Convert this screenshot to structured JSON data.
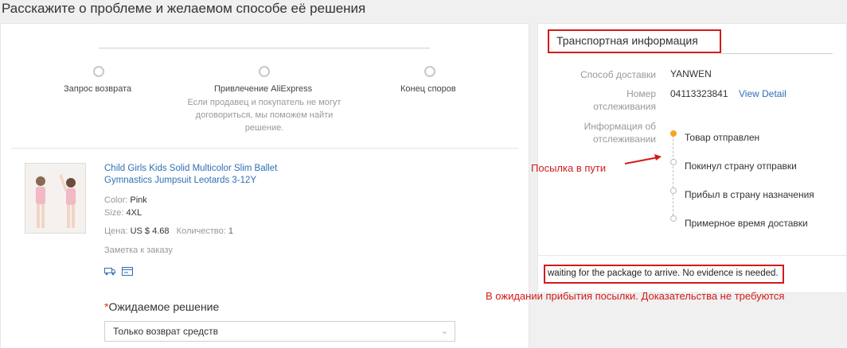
{
  "page": {
    "title": "Расскажите о проблеме и желаемом способе её решения"
  },
  "steps": [
    {
      "label": "Запрос возврата",
      "desc": ""
    },
    {
      "label": "Привлечение AliExpress",
      "desc": "Если продавец и покупатель не могут договориться, мы поможем найти решение."
    },
    {
      "label": "Конец споров",
      "desc": ""
    }
  ],
  "product": {
    "name": "Child Girls Kids Solid Multicolor Slim Ballet Gymnastics Jumpsuit Leotards 3-12Y",
    "color_label": "Color:",
    "color_value": "Pink",
    "size_label": "Size:",
    "size_value": "4XL",
    "price_label": "Цена:",
    "price_value": "US $ 4.68",
    "qty_label": "Количество:",
    "qty_value": "1",
    "order_note": "Заметка к заказу",
    "icons": [
      "shipping-icon",
      "card-icon"
    ]
  },
  "solution": {
    "required_mark": "*",
    "label": "Ожидаемое решение",
    "selected": "Только возврат средств"
  },
  "shipping": {
    "title": "Транспортная информация",
    "method_label": "Способ доставки",
    "method_value": "YANWEN",
    "tracking_label": "Номер отслеживания",
    "tracking_value": "04113323841",
    "view_detail": "View Detail",
    "info_label": "Информация об отслеживании",
    "statuses": [
      {
        "label": "Товар отправлен",
        "active": true
      },
      {
        "label": "Покинул страну отправки",
        "active": false
      },
      {
        "label": "Прибыл в страну назначения",
        "active": false
      },
      {
        "label": "Примерное время доставки",
        "active": false
      }
    ],
    "evidence_note": "waiting for the package to arrive. No evidence is needed."
  },
  "annotations": {
    "in_transit": "Посылка в пути",
    "waiting": "В ожидании прибытия посылки. Доказательства не требуются"
  },
  "colors": {
    "link": "#2f6fb5",
    "highlight_red": "#d31a1a",
    "active_status": "#f5a623"
  }
}
